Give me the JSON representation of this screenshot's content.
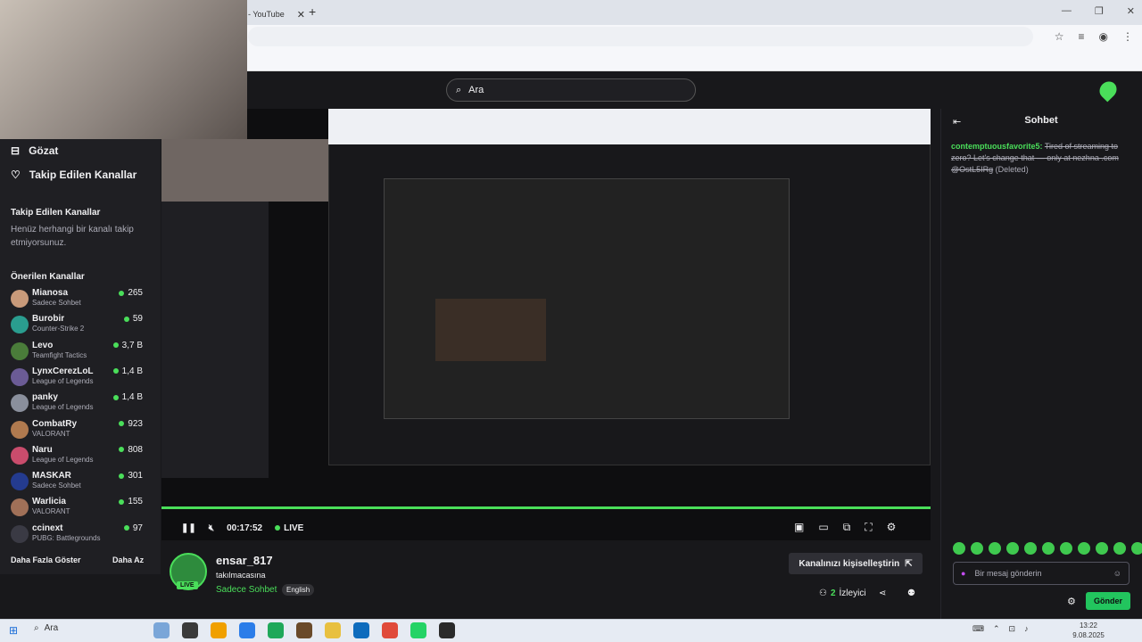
{
  "browser": {
    "tab_title": "- YouTube",
    "tab_close": "✕",
    "new_tab": "+",
    "window_controls": [
      "—",
      "❐",
      "✕"
    ],
    "address_icons": [
      "☆",
      "≡",
      "◉",
      "⋮"
    ]
  },
  "header": {
    "search_placeholder": "Ara",
    "search_icon": "search-icon",
    "logo_icon": "logo-icon"
  },
  "sidebar": {
    "nav": [
      {
        "label": "Gözat",
        "icon": "browse-icon"
      },
      {
        "label": "Takip Edilen Kanallar",
        "icon": "heart-icon"
      }
    ],
    "followed_title": "Takip Edilen Kanallar",
    "followed_empty": "Henüz herhangi bir kanalı takip etmiyorsunuz.",
    "recommended_title": "Önerilen Kanallar",
    "channels": [
      {
        "name": "Mianosa",
        "game": "Sadece Sohbet",
        "viewers": "265",
        "color": "#c89a7a"
      },
      {
        "name": "Burobir",
        "game": "Counter-Strike 2",
        "viewers": "59",
        "color": "#2a9d8f"
      },
      {
        "name": "Levo",
        "game": "Teamfight Tactics",
        "viewers": "3,7 B",
        "color": "#4a7c3a"
      },
      {
        "name": "LynxCerezLoL",
        "game": "League of Legends",
        "viewers": "1,4 B",
        "color": "#6b5b95"
      },
      {
        "name": "panky",
        "game": "League of Legends",
        "viewers": "1,4 B",
        "color": "#8a8f9c"
      },
      {
        "name": "CombatRy",
        "game": "VALORANT",
        "viewers": "923",
        "color": "#b07a4f"
      },
      {
        "name": "Naru",
        "game": "League of Legends",
        "viewers": "808",
        "color": "#c94c6c"
      },
      {
        "name": "MASKAR",
        "game": "Sadece Sohbet",
        "viewers": "301",
        "color": "#243b8f"
      },
      {
        "name": "Warlicia",
        "game": "VALORANT",
        "viewers": "155",
        "color": "#a07058"
      },
      {
        "name": "ccinext",
        "game": "PUBG: Battlegrounds",
        "viewers": "97",
        "color": "#3a3a44"
      }
    ],
    "show_more": "Daha Fazla Göster",
    "show_less": "Daha Az"
  },
  "player": {
    "time": "00:17:52",
    "live_label": "LIVE",
    "play_icon": "pause-icon",
    "mute_icon": "mute-icon"
  },
  "channel": {
    "name": "ensar_817",
    "title": "takılmacasına",
    "category": "Sadece Sohbet",
    "tag": "English",
    "live_tag": "LIVE",
    "customize_label": "Kanalınızı kişiselleştirin",
    "viewer_count": "2",
    "viewer_label": "İzleyici"
  },
  "chat": {
    "title": "Sohbet",
    "message_user": "contemptuousfavorite5:",
    "message_text": "Tired of streaming to zero? Let's change that — only at nezhna .com @OstL5IRg",
    "message_deleted": "(Deleted)",
    "input_placeholder": "Bir mesaj gönderin",
    "send_label": "Gönder",
    "emote_count": 11
  },
  "taskbar": {
    "search_label": "Ara",
    "time": "13:22",
    "date": "9.08.2025",
    "apps": [
      "#7aa6d8",
      "#3a3a3a",
      "#f0a000",
      "#2b7de9",
      "#1fa85a",
      "#6a4a2a",
      "#e8c040",
      "#0f6cbd",
      "#e04a3a",
      "#25d366",
      "#2a2a2a"
    ]
  }
}
